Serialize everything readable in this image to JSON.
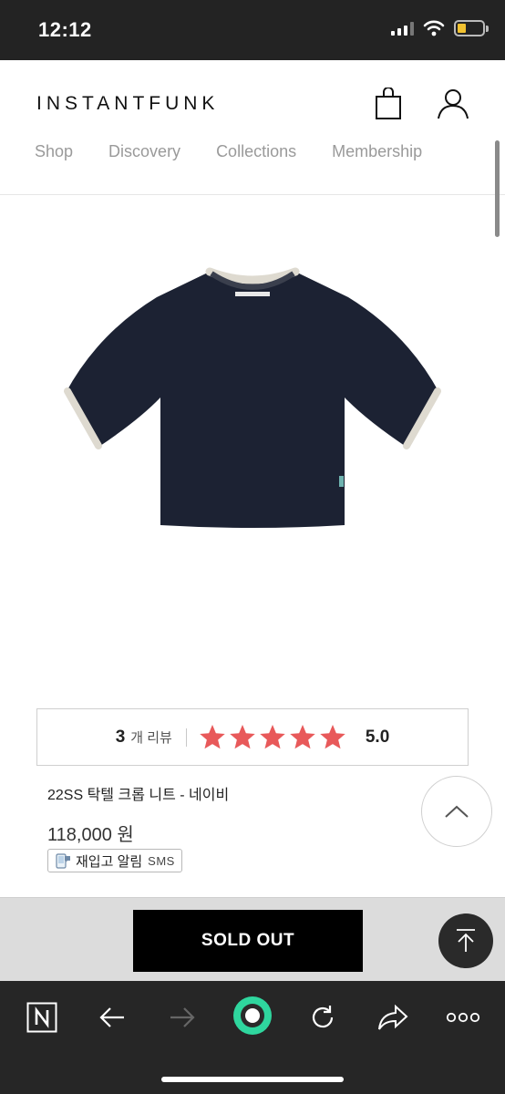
{
  "status": {
    "time": "12:12"
  },
  "header": {
    "logo": "INSTANTFUNK",
    "nav": [
      "Shop",
      "Discovery",
      "Collections",
      "Membership"
    ]
  },
  "product": {
    "review_count": "3",
    "review_label": "개 리뷰",
    "rating": "5.0",
    "rating_stars": 5,
    "rating_color": "#e8595a",
    "title": "22SS 탁텔 크롭 니트 - 네이비",
    "price": "118,000 원",
    "restock_label": "재입고 알림",
    "restock_sms": "SMS"
  },
  "action": {
    "sold_out": "SOLD OUT"
  },
  "icons": {
    "bag": "shopping-bag-icon",
    "user": "user-icon",
    "scroll_up": "chevron-up-icon",
    "top": "arrow-to-top-icon",
    "browser": [
      "n-icon",
      "back-arrow-icon",
      "forward-arrow-icon",
      "green-circle-icon",
      "refresh-icon",
      "share-icon",
      "more-icon"
    ]
  }
}
